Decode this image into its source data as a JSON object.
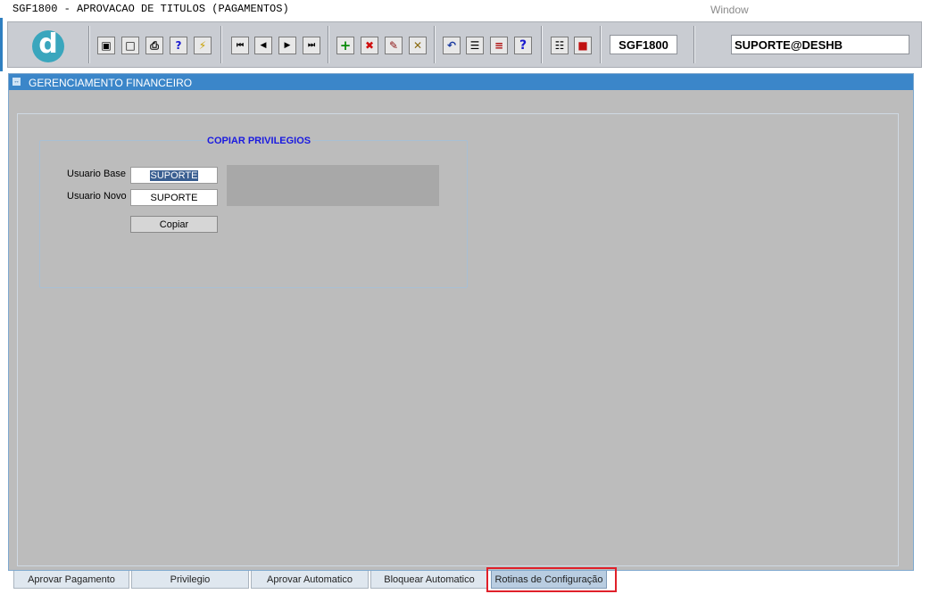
{
  "window": {
    "title": "SGF1800 - APROVACAO DE TITULOS (PAGAMENTOS)",
    "menu_window": "Window"
  },
  "toolbar": {
    "logo_letter": "d",
    "buttons": [
      {
        "name": "save-icon",
        "glyph": "▣"
      },
      {
        "name": "window-icon",
        "glyph": "□"
      },
      {
        "name": "print-icon",
        "glyph": "⎙"
      },
      {
        "name": "help-query-icon",
        "glyph": "?"
      },
      {
        "name": "execute-query-icon",
        "glyph": "⚡"
      },
      {
        "name": "first-record-icon",
        "glyph": "⏮"
      },
      {
        "name": "previous-record-icon",
        "glyph": "◀"
      },
      {
        "name": "next-record-icon",
        "glyph": "▶"
      },
      {
        "name": "last-record-icon",
        "glyph": "⏭"
      },
      {
        "name": "insert-record-icon",
        "glyph": "+"
      },
      {
        "name": "delete-record-icon",
        "glyph": "✖"
      },
      {
        "name": "edit-record-icon",
        "glyph": "✎"
      },
      {
        "name": "clear-record-icon",
        "glyph": "✕"
      },
      {
        "name": "undo-icon",
        "glyph": "↶"
      },
      {
        "name": "clipboard-icon",
        "glyph": "☰"
      },
      {
        "name": "list-values-icon",
        "glyph": "≡"
      },
      {
        "name": "help-icon",
        "glyph": "?"
      },
      {
        "name": "menu-icon",
        "glyph": "☷"
      },
      {
        "name": "exit-icon",
        "glyph": "■"
      }
    ],
    "form_code": "SGF1800",
    "user_connection": "SUPORTE@DESHB"
  },
  "panel": {
    "title": "GERENCIAMENTO FINANCEIRO"
  },
  "copy_privileges": {
    "frame_title": "COPIAR PRIVILEGIOS",
    "base_user_label": "Usuario Base",
    "base_user_value": "SUPORTE",
    "new_user_label": "Usuario Novo",
    "new_user_value": "SUPORTE",
    "copy_button": "Copiar"
  },
  "tabs": [
    {
      "label": "Aprovar Pagamento"
    },
    {
      "label": "Privilegio"
    },
    {
      "label": "Aprovar Automatico"
    },
    {
      "label": "Bloquear Automatico"
    },
    {
      "label": "Rotinas de Configuração",
      "active": true
    }
  ],
  "colors": {
    "panel_header": "#3b86c9",
    "panel_background": "#bcbcbc",
    "frame_title": "#1a1ae0",
    "highlight": "#e0202a"
  }
}
